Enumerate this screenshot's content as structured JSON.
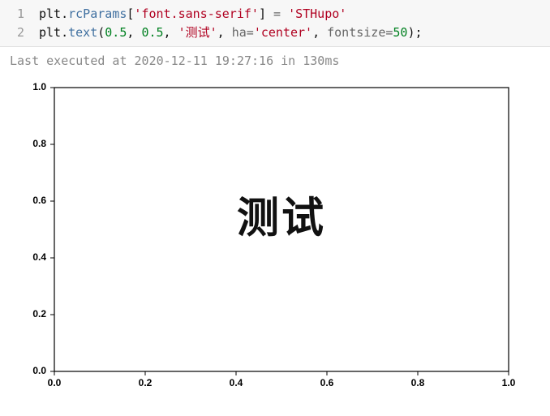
{
  "code": {
    "lines": [
      "1",
      "2"
    ],
    "line1": {
      "obj": "plt",
      "dot": ".",
      "attr": "rcParams",
      "lb": "[",
      "key": "'font.sans-serif'",
      "rb": "]",
      "eq": " = ",
      "val": "'STHupo'"
    },
    "line2": {
      "obj": "plt",
      "dot": ".",
      "fn": "text",
      "lp": "(",
      "x": "0.5",
      "c1": ", ",
      "y": "0.5",
      "c2": ", ",
      "s": "'测试'",
      "c3": ", ",
      "hak": "ha",
      "haeq": "=",
      "hav": "'center'",
      "c4": ", ",
      "fsk": "fontsize",
      "fseq": "=",
      "fsv": "50",
      "rp": ")",
      "semi": ";"
    }
  },
  "exec_status": "Last executed at 2020-12-11 19:27:16 in 130ms",
  "chart_data": {
    "type": "scatter",
    "title": "",
    "xlabel": "",
    "ylabel": "",
    "xlim": [
      0.0,
      1.0
    ],
    "ylim": [
      0.0,
      1.0
    ],
    "xticks": [
      "0.0",
      "0.2",
      "0.4",
      "0.6",
      "0.8",
      "1.0"
    ],
    "yticks": [
      "0.0",
      "0.2",
      "0.4",
      "0.6",
      "0.8",
      "1.0"
    ],
    "annotations": [
      {
        "x": 0.5,
        "y": 0.5,
        "text": "测试",
        "ha": "center",
        "fontsize": 50
      }
    ],
    "series": []
  }
}
